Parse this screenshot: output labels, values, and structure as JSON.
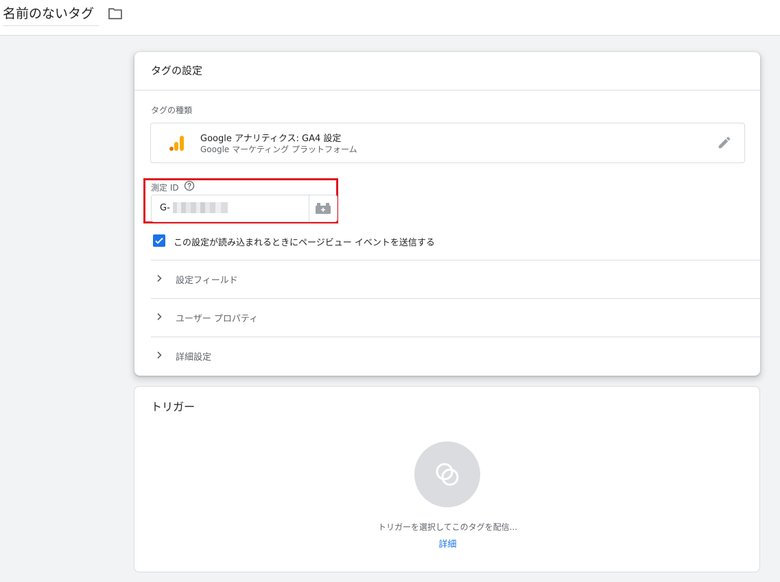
{
  "header": {
    "tag_name": "名前のないタグ",
    "folder_icon": "folder-icon"
  },
  "tag_config": {
    "title": "タグの設定",
    "tag_type_label": "タグの種類",
    "tag_type": {
      "icon": "google-analytics-icon",
      "name": "Google アナリティクス: GA4 設定",
      "subtitle": "Google マーケティング プラットフォーム",
      "edit_icon": "pencil-icon"
    },
    "measurement_id": {
      "label": "測定 ID",
      "help_icon": "help-icon",
      "value": "G-",
      "variable_icon": "variable-icon"
    },
    "pageview_checkbox": {
      "checked": true,
      "label": "この設定が読み込まれるときにページビュー イベントを送信する"
    },
    "sections": [
      {
        "label": "設定フィールド"
      },
      {
        "label": "ユーザー プロパティ"
      },
      {
        "label": "詳細設定"
      }
    ]
  },
  "trigger": {
    "title": "トリガー",
    "empty_icon": "trigger-circles-icon",
    "hint": "トリガーを選択してこのタグを配信...",
    "link": "詳細"
  },
  "colors": {
    "accent": "#1a73e8",
    "highlight": "#e0141c",
    "ga_orange": "#f9ab00",
    "ga_dark_orange": "#e37400"
  }
}
